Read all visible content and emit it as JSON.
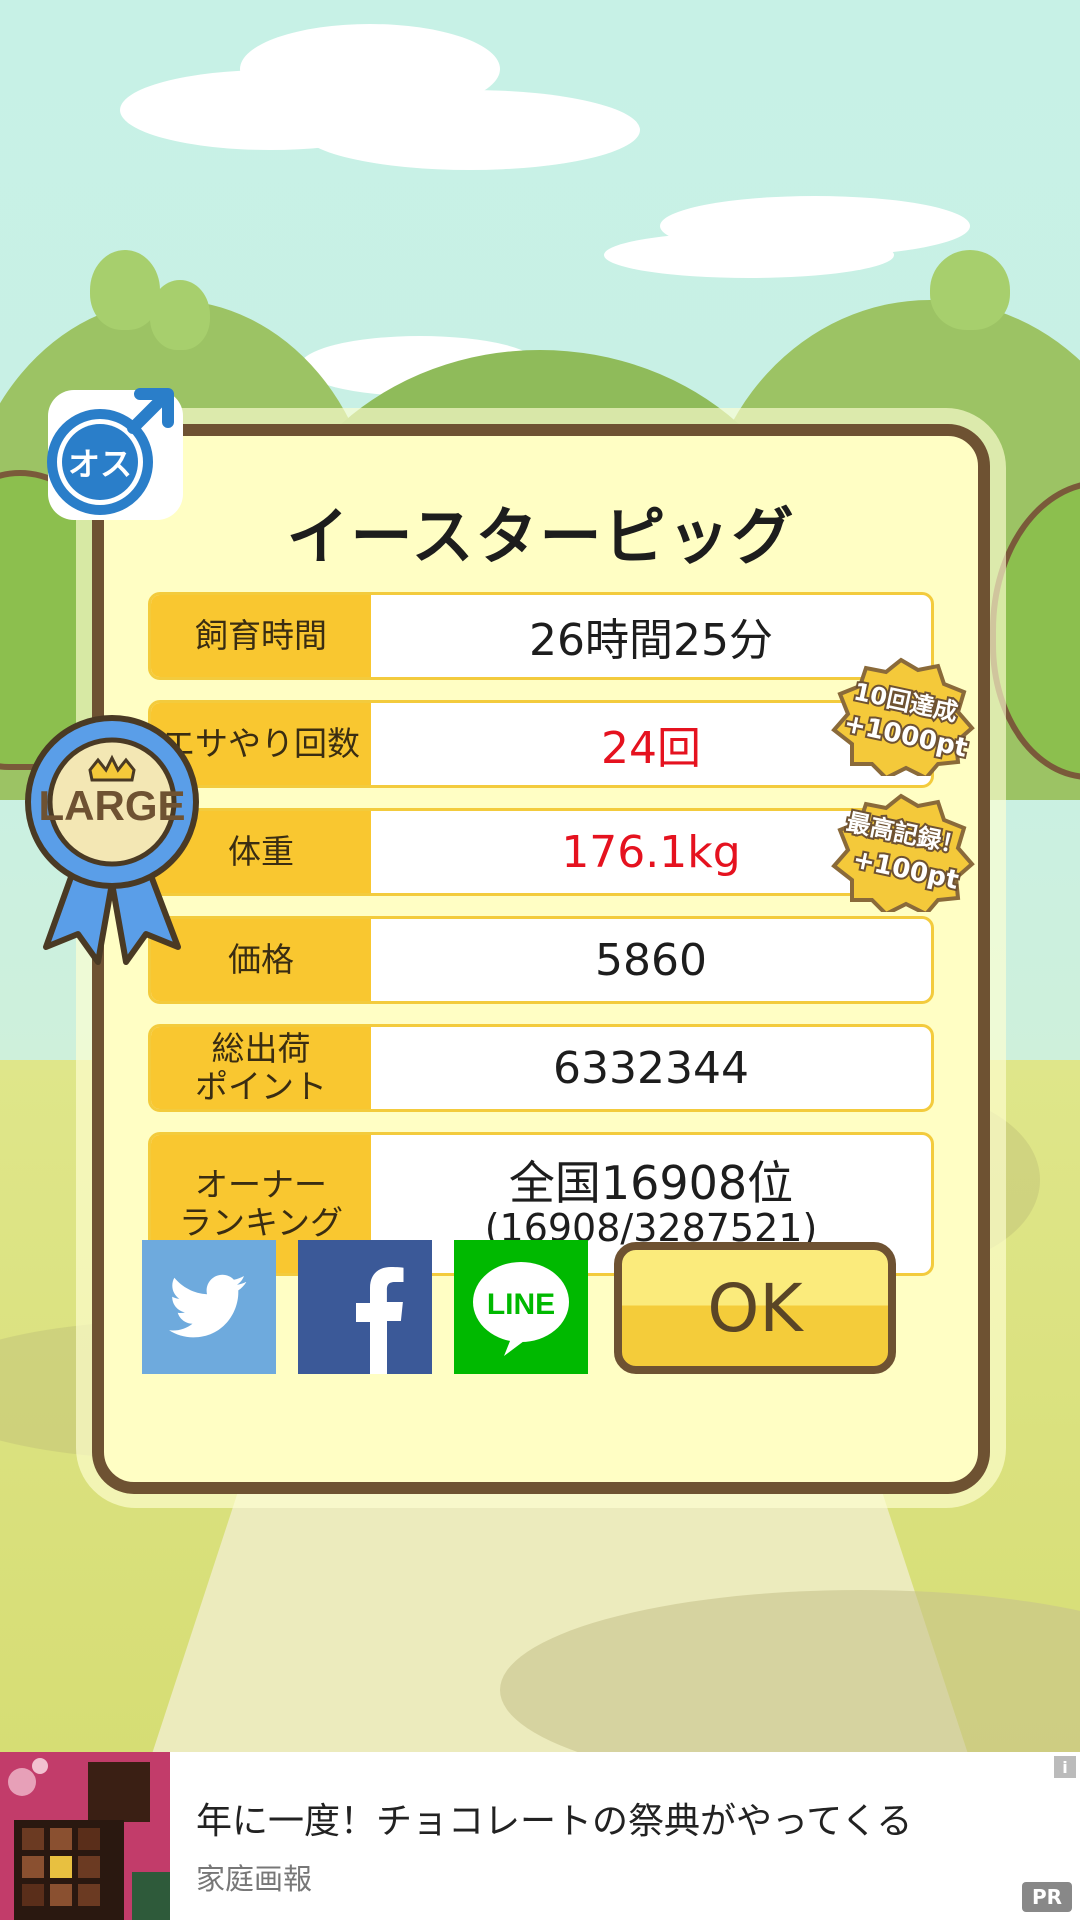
{
  "dialog": {
    "title": "イースターピッグ",
    "gender_badge": "オス",
    "size_ribbon": "LARGE",
    "stats": [
      {
        "label": "飼育時間",
        "value": "26時間25分",
        "highlight": false
      },
      {
        "label": "エサやり回数",
        "value": "24回",
        "highlight": true
      },
      {
        "label": "体重",
        "value": "176.1kg",
        "highlight": true
      },
      {
        "label": "価格",
        "value": "5860",
        "highlight": false
      },
      {
        "label_line1": "総出荷",
        "label_line2": "ポイント",
        "value": "6332344",
        "highlight": false
      },
      {
        "label_line1": "オーナー",
        "label_line2": "ランキング",
        "value_line1": "全国16908位",
        "value_line2": "(16908/3287521)",
        "highlight": false
      }
    ],
    "achievements": [
      {
        "line1": "10回達成",
        "line2": "+1000pt"
      },
      {
        "line1": "最高記録！",
        "line2": "+100pt"
      }
    ],
    "share_buttons": [
      "twitter-icon",
      "facebook-icon",
      "line-icon"
    ],
    "line_label": "LINE",
    "ok_label": "OK"
  },
  "ad": {
    "title": "年に一度！チョコレートの祭典がやってくる",
    "source": "家庭画報",
    "pr_label": "PR",
    "info_label": "i"
  },
  "colors": {
    "label_bg": "#f9c730",
    "highlight_text": "#e5121f",
    "frame": "#6e5232",
    "panel": "#fffec4"
  }
}
